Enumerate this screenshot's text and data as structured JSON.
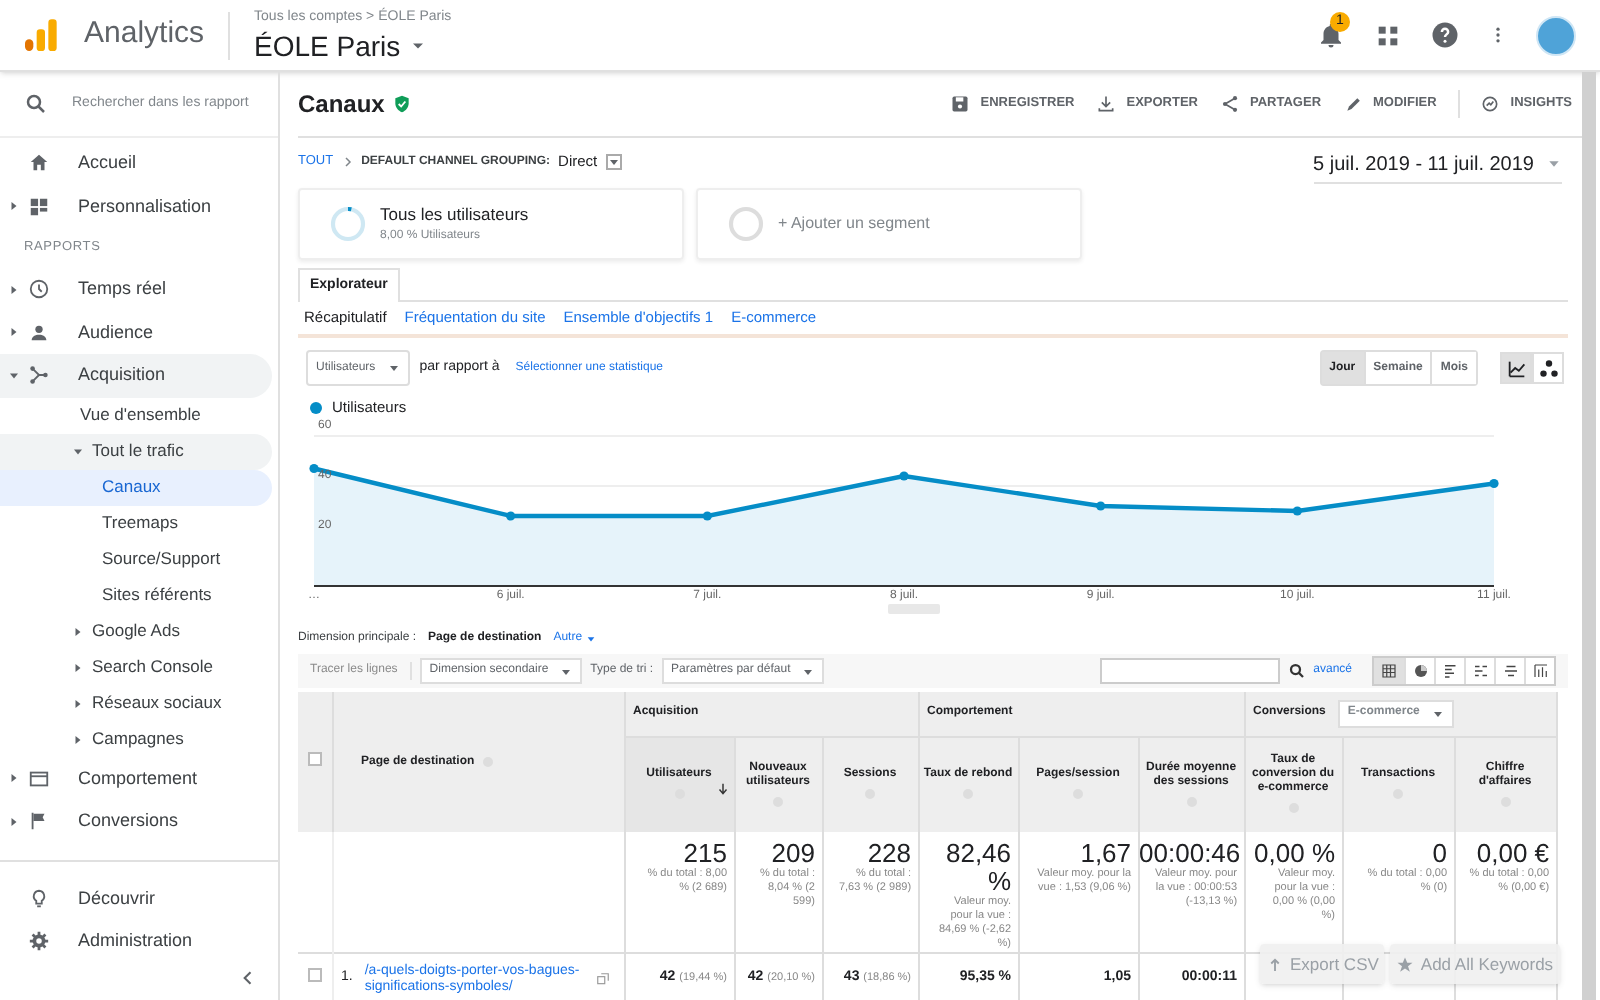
{
  "topbar": {
    "product": "Analytics",
    "breadcrumb": "Tous les comptes > ÉOLE Paris",
    "account": "ÉOLE Paris",
    "notifications": "1"
  },
  "sidebar": {
    "search_placeholder": "Rechercher dans les rapport",
    "groups": [
      {
        "items": [
          {
            "label": "Accueil",
            "selected": false
          },
          {
            "label": "Personnalisation",
            "expanded": false,
            "selected": false
          }
        ]
      },
      {
        "label": "RAPPORTS",
        "items": [
          {
            "label": "Temps réel",
            "expanded": false,
            "selected": false
          },
          {
            "label": "Audience",
            "expanded": false,
            "selected": false
          },
          {
            "label": "Acquisition",
            "expanded": true,
            "selected": false,
            "children": [
              {
                "label": "Vue d'ensemble",
                "selected": false
              },
              {
                "label": "Tout le trafic",
                "expanded": true,
                "selected": false,
                "children": [
                  {
                    "label": "Canaux",
                    "selected": true
                  },
                  {
                    "label": "Treemaps",
                    "selected": false
                  },
                  {
                    "label": "Source/Support",
                    "selected": false
                  },
                  {
                    "label": "Sites référents",
                    "selected": false
                  }
                ]
              },
              {
                "label": "Google Ads",
                "expanded": false,
                "selected": false
              },
              {
                "label": "Search Console",
                "expanded": false,
                "selected": false
              },
              {
                "label": "Réseaux sociaux",
                "expanded": false,
                "selected": false
              },
              {
                "label": "Campagnes",
                "expanded": false,
                "selected": false
              }
            ]
          },
          {
            "label": "Comportement",
            "expanded": false,
            "selected": false
          },
          {
            "label": "Conversions",
            "expanded": false,
            "selected": false
          }
        ]
      },
      {
        "items": [
          {
            "label": "Découvrir",
            "selected": false
          },
          {
            "label": "Administration",
            "selected": false
          }
        ]
      }
    ]
  },
  "report": {
    "title": "Canaux",
    "actions": [
      "ENREGISTRER",
      "EXPORTER",
      "PARTAGER",
      "MODIFIER",
      "INSIGHTS"
    ],
    "breadcrumb": {
      "root": "TOUT",
      "grouping": "DEFAULT CHANNEL GROUPING:",
      "value": "Direct"
    },
    "date_range": "5 juil. 2019 - 11 juil. 2019",
    "segments": [
      {
        "kind": "segment",
        "title": "Tous les utilisateurs",
        "subtitle": "8,00 % Utilisateurs"
      },
      {
        "kind": "add",
        "title": "+ Ajouter un segment"
      }
    ],
    "tabs": [
      {
        "label": "Explorateur",
        "selected": true
      }
    ],
    "subtabs": [
      {
        "label": "Récapitulatif",
        "selected": true
      },
      {
        "label": "Fréquentation du site",
        "selected": false
      },
      {
        "label": "Ensemble d'objectifs 1",
        "selected": false
      },
      {
        "label": "E-commerce",
        "selected": false
      }
    ],
    "metric": "Utilisateurs",
    "compare_label": "par rapport à",
    "compare_link": "Sélectionner une statistique",
    "granularity": [
      {
        "label": "Jour",
        "selected": true
      },
      {
        "label": "Semaine",
        "selected": false
      },
      {
        "label": "Mois",
        "selected": false
      }
    ],
    "chart_types": [
      {
        "selected": true
      },
      {
        "selected": false
      }
    ],
    "chart_data": {
      "type": "area",
      "categories": [
        "…",
        "6 juil.",
        "7 juil.",
        "8 juil.",
        "9 juil.",
        "10 juil.",
        "11 juil."
      ],
      "ylim": [
        0,
        60
      ],
      "yticks": [
        20,
        40,
        60
      ],
      "series": [
        {
          "name": "Utilisateurs",
          "color": "#058dc7",
          "values": [
            47,
            28,
            28,
            44,
            32,
            30,
            41
          ]
        }
      ]
    },
    "dimension": {
      "label": "Dimension principale :",
      "value": "Page de destination",
      "other": "Autre"
    },
    "toolbar": {
      "plot_rows": "Tracer les lignes",
      "secondary": "Dimension secondaire",
      "sort_label": "Type de tri :",
      "sort": "Paramètres par défaut",
      "advanced": "avancé",
      "views": [
        {
          "selected": true
        },
        {
          "selected": false
        },
        {
          "selected": false
        },
        {
          "selected": false
        },
        {
          "selected": false
        },
        {
          "selected": false
        }
      ]
    },
    "table": {
      "select_all_checked": false,
      "dimension_column": "Page de destination",
      "groups": [
        {
          "label": "Acquisition",
          "columns": [
            {
              "label": "Utilisateurs",
              "sorted": true
            },
            {
              "label": "Nouveaux utilisateurs",
              "sorted": false
            },
            {
              "label": "Sessions",
              "sorted": false
            }
          ]
        },
        {
          "label": "Comportement",
          "columns": [
            {
              "label": "Taux de rebond",
              "sorted": false
            },
            {
              "label": "Pages/session",
              "sorted": false
            },
            {
              "label": "Durée moyenne des sessions",
              "sorted": false
            }
          ]
        },
        {
          "label": "Conversions",
          "selector": "E-commerce",
          "columns": [
            {
              "label": "Taux de conversion du e-commerce",
              "sorted": false
            },
            {
              "label": "Transactions",
              "sorted": false
            },
            {
              "label": "Chiffre d'affaires",
              "sorted": false
            }
          ]
        }
      ],
      "totals": [
        {
          "value": "215",
          "note": "% du total : 8,00 % (2 689)"
        },
        {
          "value": "209",
          "note": "% du total : 8,04 % (2 599)"
        },
        {
          "value": "228",
          "note": "% du total : 7,63 % (2 989)"
        },
        {
          "value": "82,46 %",
          "note": "Valeur moy. pour la vue : 84,69 % (-2,62 %)"
        },
        {
          "value": "1,67",
          "note": "Valeur moy. pour la vue : 1,53 (9,06 %)"
        },
        {
          "value": "00:00:46",
          "note": "Valeur moy. pour la vue : 00:00:53 (-13,13 %)"
        },
        {
          "value": "0,00 %",
          "note": "Valeur moy. pour la vue : 0,00 % (0,00 %)"
        },
        {
          "value": "0",
          "note": "% du total : 0,00 % (0)"
        },
        {
          "value": "0,00 €",
          "note": "% du total : 0,00 % (0,00 €)"
        }
      ],
      "rows": [
        {
          "index": "1.",
          "page": "/a-quels-doigts-porter-vos-bagues-significations-symboles/",
          "checked": false,
          "cells": [
            {
              "value": "42",
              "share": "(19,44 %)"
            },
            {
              "value": "42",
              "share": "(20,10 %)"
            },
            {
              "value": "43",
              "share": "(18,86 %)"
            },
            {
              "value": "95,35 %"
            },
            {
              "value": "1,05"
            },
            {
              "value": "00:00:11"
            }
          ]
        }
      ]
    }
  },
  "overlay_buttons": [
    "Export CSV",
    "Add All Keywords"
  ]
}
